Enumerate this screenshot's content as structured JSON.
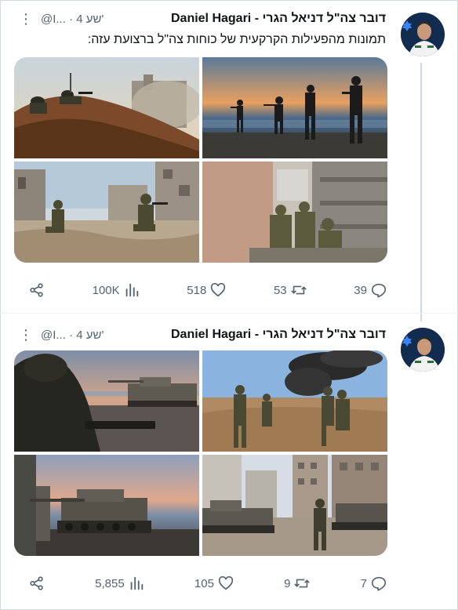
{
  "tweets": [
    {
      "author_name": "Daniel Hagari - דובר צה\"ל דניאל הגרי",
      "handle": "@I...",
      "time": "4 שע'",
      "text": "תמונות מהפעילות הקרקעית של כוחות צה\"ל ברצועת עזה:",
      "stats": {
        "views": "100K",
        "likes": "518",
        "retweets": "53",
        "replies": "39"
      }
    },
    {
      "author_name": "Daniel Hagari - דובר צה\"ל דניאל הגרי",
      "handle": "@I...",
      "time": "4 שע'",
      "text": "",
      "stats": {
        "views": "5,855",
        "likes": "105",
        "retweets": "9",
        "replies": "7"
      }
    }
  ],
  "icons": {
    "share": "share-icon",
    "views": "bar-chart-icon",
    "like": "heart-icon",
    "retweet": "retweet-icon",
    "reply": "reply-icon",
    "more": "more-vertical-icon"
  },
  "colors": {
    "text": "#0f1419",
    "muted": "#536471",
    "border": "#cfd9de"
  }
}
